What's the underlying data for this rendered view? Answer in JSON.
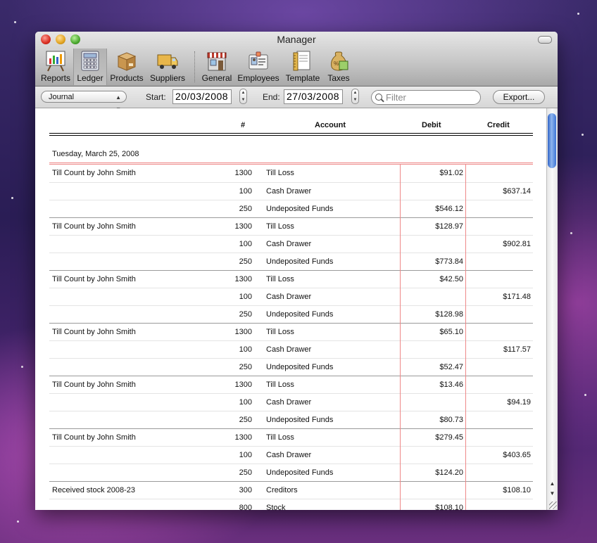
{
  "window": {
    "title": "Manager"
  },
  "toolbar": {
    "items": [
      {
        "label": "Reports",
        "icon": "chart-easel-icon"
      },
      {
        "label": "Ledger",
        "icon": "ledger-calculator-icon",
        "active": true
      },
      {
        "label": "Products",
        "icon": "box-icon"
      },
      {
        "label": "Suppliers",
        "icon": "truck-icon"
      },
      {
        "label": "General",
        "icon": "storefront-icon"
      },
      {
        "label": "Employees",
        "icon": "id-badge-icon"
      },
      {
        "label": "Template",
        "icon": "ruler-paper-icon"
      },
      {
        "label": "Taxes",
        "icon": "money-bag-icon"
      }
    ]
  },
  "filterbar": {
    "view_select": "Journal",
    "start_label": "Start:",
    "start_value": "20/03/2008",
    "end_label": "End:",
    "end_value": "27/03/2008",
    "filter_placeholder": "Filter",
    "export_label": "Export..."
  },
  "table": {
    "headers": {
      "num": "#",
      "account": "Account",
      "debit": "Debit",
      "credit": "Credit"
    },
    "date_heading": "Tuesday, March 25, 2008",
    "rows": [
      {
        "desc": "Till Count by John Smith",
        "num": "1300",
        "account": "Till Loss",
        "debit": "$91.02",
        "credit": ""
      },
      {
        "desc": "",
        "num": "100",
        "account": "Cash Drawer",
        "debit": "",
        "credit": "$637.14"
      },
      {
        "desc": "",
        "num": "250",
        "account": "Undeposited Funds",
        "debit": "$546.12",
        "credit": ""
      },
      {
        "desc": "Till Count by John Smith",
        "num": "1300",
        "account": "Till Loss",
        "debit": "$128.97",
        "credit": ""
      },
      {
        "desc": "",
        "num": "100",
        "account": "Cash Drawer",
        "debit": "",
        "credit": "$902.81"
      },
      {
        "desc": "",
        "num": "250",
        "account": "Undeposited Funds",
        "debit": "$773.84",
        "credit": ""
      },
      {
        "desc": "Till Count by John Smith",
        "num": "1300",
        "account": "Till Loss",
        "debit": "$42.50",
        "credit": ""
      },
      {
        "desc": "",
        "num": "100",
        "account": "Cash Drawer",
        "debit": "",
        "credit": "$171.48"
      },
      {
        "desc": "",
        "num": "250",
        "account": "Undeposited Funds",
        "debit": "$128.98",
        "credit": ""
      },
      {
        "desc": "Till Count by John Smith",
        "num": "1300",
        "account": "Till Loss",
        "debit": "$65.10",
        "credit": ""
      },
      {
        "desc": "",
        "num": "100",
        "account": "Cash Drawer",
        "debit": "",
        "credit": "$117.57"
      },
      {
        "desc": "",
        "num": "250",
        "account": "Undeposited Funds",
        "debit": "$52.47",
        "credit": ""
      },
      {
        "desc": "Till Count by John Smith",
        "num": "1300",
        "account": "Till Loss",
        "debit": "$13.46",
        "credit": ""
      },
      {
        "desc": "",
        "num": "100",
        "account": "Cash Drawer",
        "debit": "",
        "credit": "$94.19"
      },
      {
        "desc": "",
        "num": "250",
        "account": "Undeposited Funds",
        "debit": "$80.73",
        "credit": ""
      },
      {
        "desc": "Till Count by John Smith",
        "num": "1300",
        "account": "Till Loss",
        "debit": "$279.45",
        "credit": ""
      },
      {
        "desc": "",
        "num": "100",
        "account": "Cash Drawer",
        "debit": "",
        "credit": "$403.65"
      },
      {
        "desc": "",
        "num": "250",
        "account": "Undeposited Funds",
        "debit": "$124.20",
        "credit": ""
      },
      {
        "desc": "Received stock 2008-23",
        "num": "300",
        "account": "Creditors",
        "debit": "",
        "credit": "$108.10"
      },
      {
        "desc": "",
        "num": "800",
        "account": "Stock",
        "debit": "$108.10",
        "credit": ""
      }
    ]
  }
}
